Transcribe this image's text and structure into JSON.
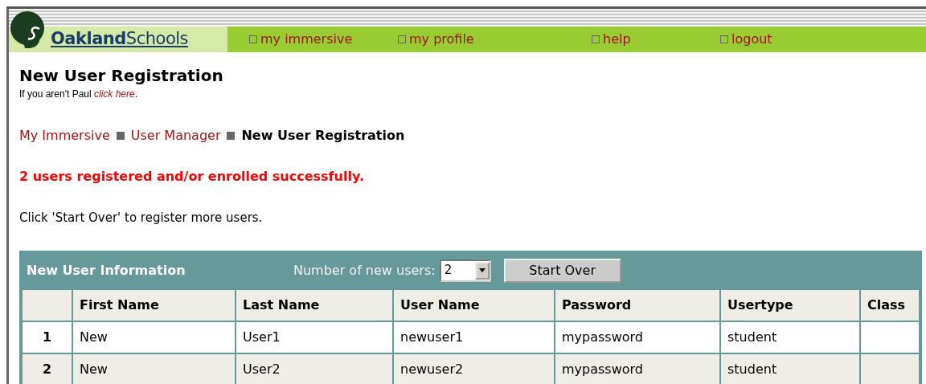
{
  "logo": {
    "text": "**Oakland**Schools"
  },
  "nav": [
    {
      "label": "my immersive"
    },
    {
      "label": "my profile"
    },
    {
      "label": "help"
    },
    {
      "label": "logout"
    }
  ],
  "page_title": "New User Registration",
  "user_note": {
    "text": "If you aren't Paul",
    "link": "click here",
    "after": "."
  },
  "breadcrumb": [
    {
      "label": "My Immersive",
      "current": false
    },
    {
      "label": "User Manager",
      "current": false
    },
    {
      "label": "New User Registration",
      "current": true
    }
  ],
  "success_message": "2 users registered and/or enrolled successfully.",
  "instructions": "Click 'Start Over' to register more users.",
  "panel": {
    "title": "New User Information",
    "count_label": "Number of new users:",
    "count_value": "2",
    "button": "Start Over"
  },
  "table": {
    "columns": [
      "First Name",
      "Last Name",
      "User Name",
      "Password",
      "Usertype",
      "Class"
    ],
    "rows": [
      {
        "number": "1",
        "cells": [
          "New",
          "User1",
          "newuser1",
          "mypassword",
          "student"
        ]
      },
      {
        "number": "2",
        "cells": [
          "New",
          "User2",
          "newuser2",
          "mypassword",
          "student"
        ]
      }
    ]
  }
}
